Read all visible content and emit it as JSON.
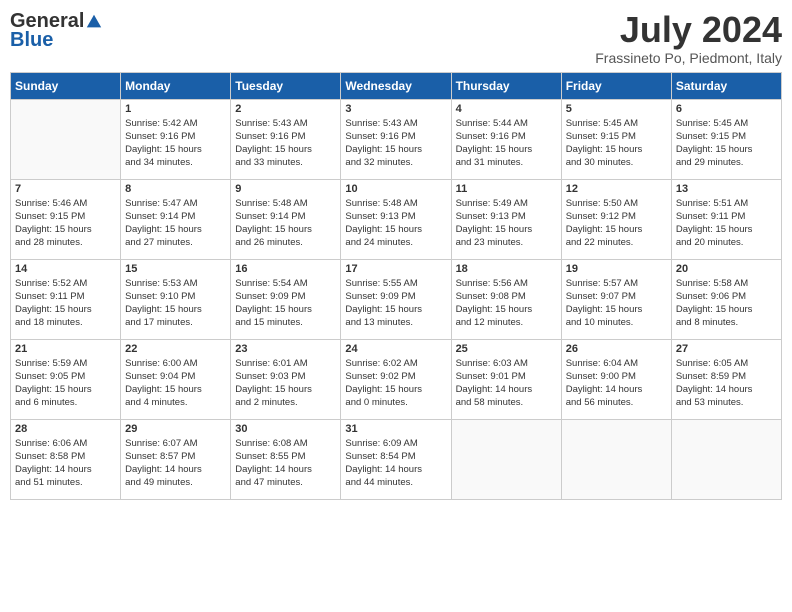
{
  "header": {
    "logo_general": "General",
    "logo_blue": "Blue",
    "month_year": "July 2024",
    "location": "Frassineto Po, Piedmont, Italy"
  },
  "days_of_week": [
    "Sunday",
    "Monday",
    "Tuesday",
    "Wednesday",
    "Thursday",
    "Friday",
    "Saturday"
  ],
  "weeks": [
    [
      {
        "num": "",
        "info": ""
      },
      {
        "num": "1",
        "info": "Sunrise: 5:42 AM\nSunset: 9:16 PM\nDaylight: 15 hours\nand 34 minutes."
      },
      {
        "num": "2",
        "info": "Sunrise: 5:43 AM\nSunset: 9:16 PM\nDaylight: 15 hours\nand 33 minutes."
      },
      {
        "num": "3",
        "info": "Sunrise: 5:43 AM\nSunset: 9:16 PM\nDaylight: 15 hours\nand 32 minutes."
      },
      {
        "num": "4",
        "info": "Sunrise: 5:44 AM\nSunset: 9:16 PM\nDaylight: 15 hours\nand 31 minutes."
      },
      {
        "num": "5",
        "info": "Sunrise: 5:45 AM\nSunset: 9:15 PM\nDaylight: 15 hours\nand 30 minutes."
      },
      {
        "num": "6",
        "info": "Sunrise: 5:45 AM\nSunset: 9:15 PM\nDaylight: 15 hours\nand 29 minutes."
      }
    ],
    [
      {
        "num": "7",
        "info": "Sunrise: 5:46 AM\nSunset: 9:15 PM\nDaylight: 15 hours\nand 28 minutes."
      },
      {
        "num": "8",
        "info": "Sunrise: 5:47 AM\nSunset: 9:14 PM\nDaylight: 15 hours\nand 27 minutes."
      },
      {
        "num": "9",
        "info": "Sunrise: 5:48 AM\nSunset: 9:14 PM\nDaylight: 15 hours\nand 26 minutes."
      },
      {
        "num": "10",
        "info": "Sunrise: 5:48 AM\nSunset: 9:13 PM\nDaylight: 15 hours\nand 24 minutes."
      },
      {
        "num": "11",
        "info": "Sunrise: 5:49 AM\nSunset: 9:13 PM\nDaylight: 15 hours\nand 23 minutes."
      },
      {
        "num": "12",
        "info": "Sunrise: 5:50 AM\nSunset: 9:12 PM\nDaylight: 15 hours\nand 22 minutes."
      },
      {
        "num": "13",
        "info": "Sunrise: 5:51 AM\nSunset: 9:11 PM\nDaylight: 15 hours\nand 20 minutes."
      }
    ],
    [
      {
        "num": "14",
        "info": "Sunrise: 5:52 AM\nSunset: 9:11 PM\nDaylight: 15 hours\nand 18 minutes."
      },
      {
        "num": "15",
        "info": "Sunrise: 5:53 AM\nSunset: 9:10 PM\nDaylight: 15 hours\nand 17 minutes."
      },
      {
        "num": "16",
        "info": "Sunrise: 5:54 AM\nSunset: 9:09 PM\nDaylight: 15 hours\nand 15 minutes."
      },
      {
        "num": "17",
        "info": "Sunrise: 5:55 AM\nSunset: 9:09 PM\nDaylight: 15 hours\nand 13 minutes."
      },
      {
        "num": "18",
        "info": "Sunrise: 5:56 AM\nSunset: 9:08 PM\nDaylight: 15 hours\nand 12 minutes."
      },
      {
        "num": "19",
        "info": "Sunrise: 5:57 AM\nSunset: 9:07 PM\nDaylight: 15 hours\nand 10 minutes."
      },
      {
        "num": "20",
        "info": "Sunrise: 5:58 AM\nSunset: 9:06 PM\nDaylight: 15 hours\nand 8 minutes."
      }
    ],
    [
      {
        "num": "21",
        "info": "Sunrise: 5:59 AM\nSunset: 9:05 PM\nDaylight: 15 hours\nand 6 minutes."
      },
      {
        "num": "22",
        "info": "Sunrise: 6:00 AM\nSunset: 9:04 PM\nDaylight: 15 hours\nand 4 minutes."
      },
      {
        "num": "23",
        "info": "Sunrise: 6:01 AM\nSunset: 9:03 PM\nDaylight: 15 hours\nand 2 minutes."
      },
      {
        "num": "24",
        "info": "Sunrise: 6:02 AM\nSunset: 9:02 PM\nDaylight: 15 hours\nand 0 minutes."
      },
      {
        "num": "25",
        "info": "Sunrise: 6:03 AM\nSunset: 9:01 PM\nDaylight: 14 hours\nand 58 minutes."
      },
      {
        "num": "26",
        "info": "Sunrise: 6:04 AM\nSunset: 9:00 PM\nDaylight: 14 hours\nand 56 minutes."
      },
      {
        "num": "27",
        "info": "Sunrise: 6:05 AM\nSunset: 8:59 PM\nDaylight: 14 hours\nand 53 minutes."
      }
    ],
    [
      {
        "num": "28",
        "info": "Sunrise: 6:06 AM\nSunset: 8:58 PM\nDaylight: 14 hours\nand 51 minutes."
      },
      {
        "num": "29",
        "info": "Sunrise: 6:07 AM\nSunset: 8:57 PM\nDaylight: 14 hours\nand 49 minutes."
      },
      {
        "num": "30",
        "info": "Sunrise: 6:08 AM\nSunset: 8:55 PM\nDaylight: 14 hours\nand 47 minutes."
      },
      {
        "num": "31",
        "info": "Sunrise: 6:09 AM\nSunset: 8:54 PM\nDaylight: 14 hours\nand 44 minutes."
      },
      {
        "num": "",
        "info": ""
      },
      {
        "num": "",
        "info": ""
      },
      {
        "num": "",
        "info": ""
      }
    ]
  ]
}
